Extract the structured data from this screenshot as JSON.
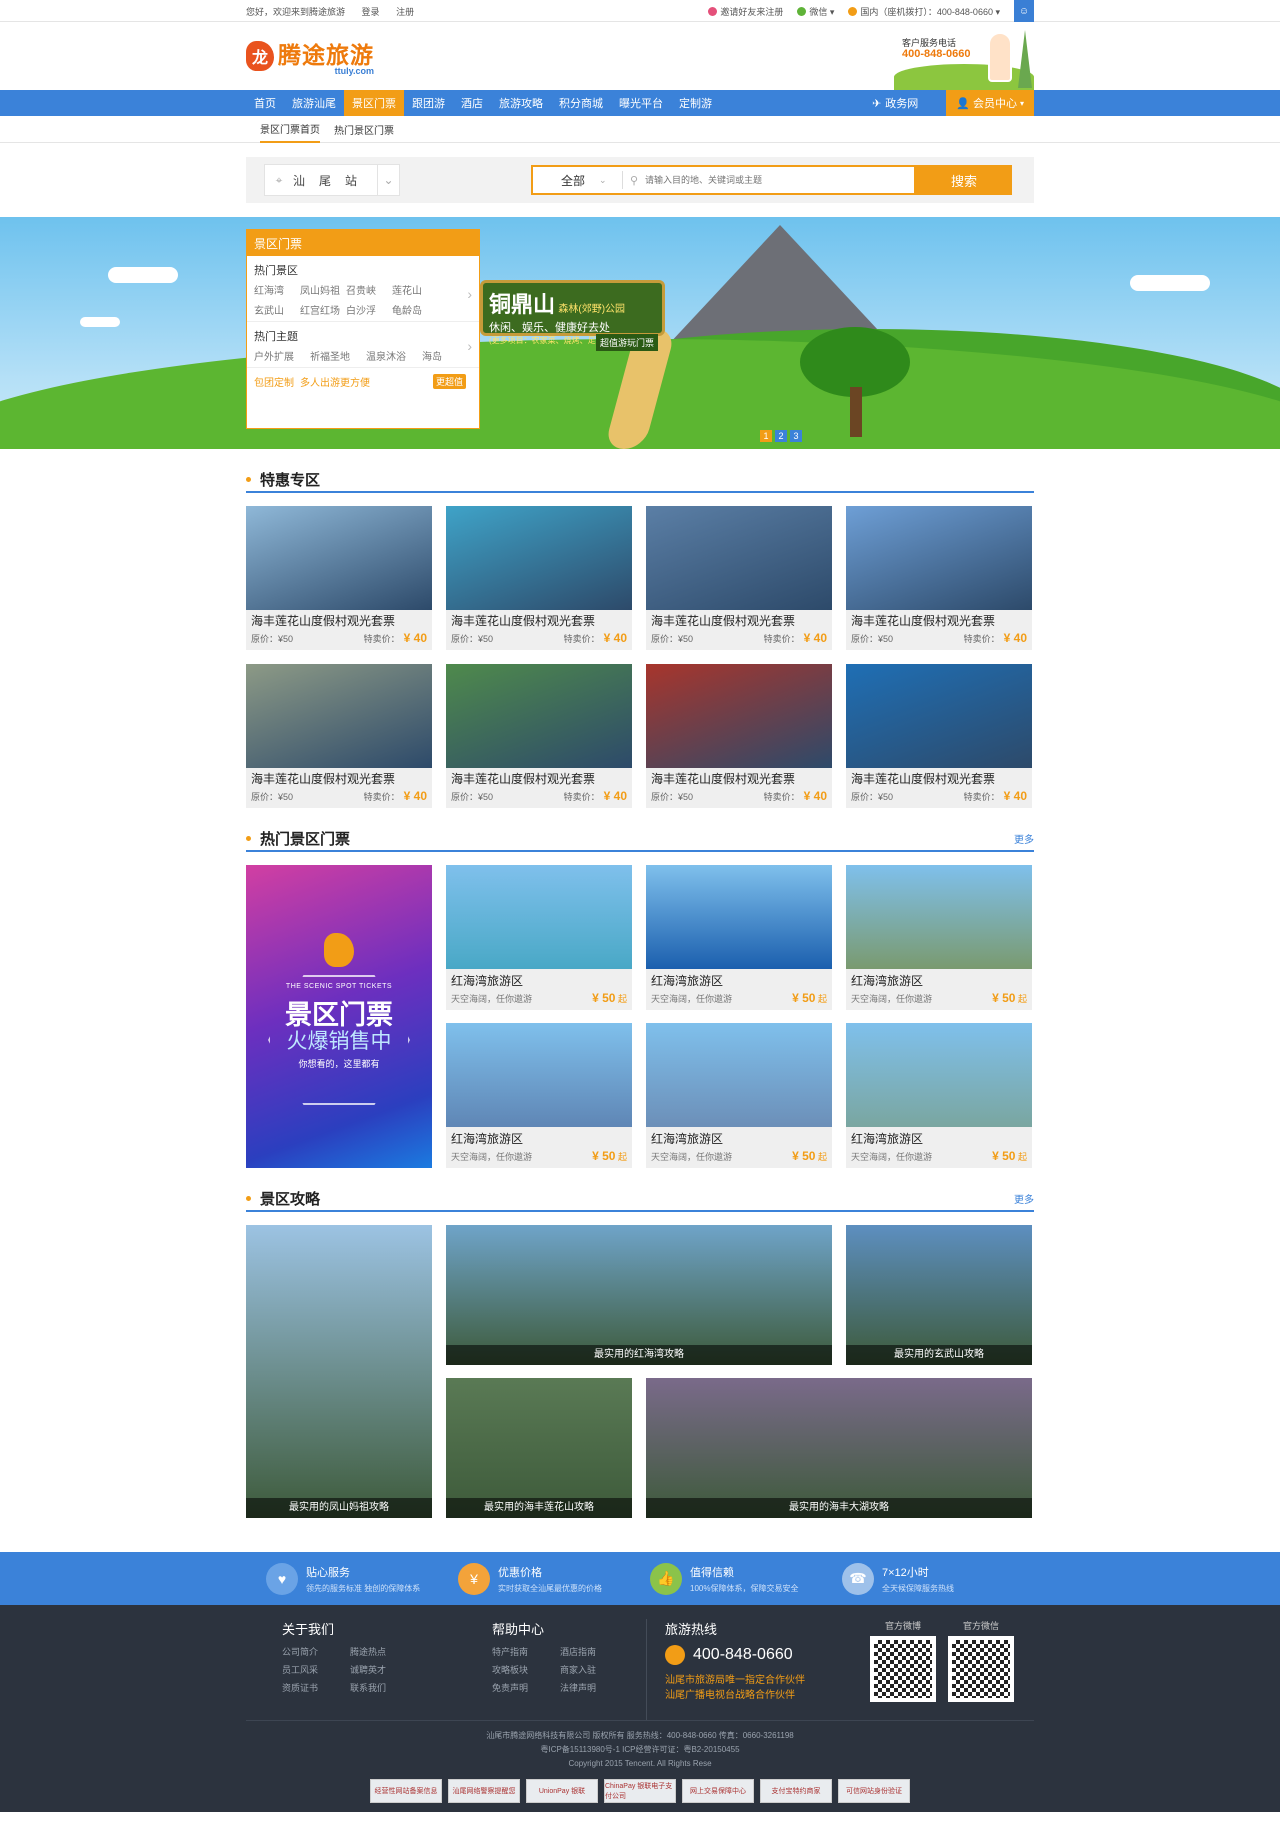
{
  "topbar": {
    "welcome": "您好，欢迎来到腾途旅游",
    "login": "登录",
    "register": "注册",
    "invite": "邀请好友来注册",
    "wechat": "微信",
    "hotline": "国内（座机拨打）：400-848-0660"
  },
  "header": {
    "logo_cn": "腾途旅游",
    "logo_en": "ttuly.com",
    "service_label": "客户服务电话",
    "service_tel": "400-848-0660"
  },
  "nav": {
    "items": [
      "首页",
      "旅游汕尾",
      "景区门票",
      "跟团游",
      "酒店",
      "旅游攻略",
      "积分商城",
      "曝光平台",
      "定制游"
    ],
    "gov": "政务网",
    "member": "会员中心"
  },
  "subnav": {
    "items": [
      "景区门票首页",
      "热门景区门票"
    ]
  },
  "search": {
    "city": "汕尾站",
    "category": "全部",
    "placeholder": "请输入目的地、关键词或主题",
    "button": "搜索"
  },
  "banner": {
    "sign_title": "铜鼎山",
    "sign_sub": "森林(郊野)公园",
    "sign_line": "休闲、娱乐、健康好去处",
    "sign_small": "(更多项目：农家菜、烧烤、足球场、游乐园)",
    "sign_tag": "超值游玩门票",
    "slides": [
      "1",
      "2",
      "3"
    ]
  },
  "panel": {
    "title": "景区门票",
    "hot_spots_title": "热门景区",
    "hot_spots": [
      "红海湾",
      "凤山妈祖",
      "召贵峡",
      "莲花山",
      "玄武山",
      "红宫红场",
      "白沙浮",
      "龟龄岛"
    ],
    "themes_title": "热门主题",
    "themes": [
      "户外扩展",
      "祈福圣地",
      "温泉沐浴",
      "海岛"
    ],
    "custom": "包团定制",
    "custom_sub": "多人出游更方便",
    "value": "更超值"
  },
  "deals": {
    "title": "特惠专区",
    "items": [
      {
        "name": "海丰莲花山度假村观光套票",
        "orig": "原价：¥50",
        "label": "特卖价：",
        "price": "¥ 40",
        "color": "#8fb8d8"
      },
      {
        "name": "海丰莲花山度假村观光套票",
        "orig": "原价：¥50",
        "label": "特卖价：",
        "price": "¥ 40",
        "color": "#3fa3c8"
      },
      {
        "name": "海丰莲花山度假村观光套票",
        "orig": "原价：¥50",
        "label": "特卖价：",
        "price": "¥ 40",
        "color": "#5b7fa6"
      },
      {
        "name": "海丰莲花山度假村观光套票",
        "orig": "原价：¥50",
        "label": "特卖价：",
        "price": "¥ 40",
        "color": "#6e9fd6"
      },
      {
        "name": "海丰莲花山度假村观光套票",
        "orig": "原价：¥50",
        "label": "特卖价：",
        "price": "¥ 40",
        "color": "#8d9a86"
      },
      {
        "name": "海丰莲花山度假村观光套票",
        "orig": "原价：¥50",
        "label": "特卖价：",
        "price": "¥ 40",
        "color": "#4f8a4c"
      },
      {
        "name": "海丰莲花山度假村观光套票",
        "orig": "原价：¥50",
        "label": "特卖价：",
        "price": "¥ 40",
        "color": "#a8352c"
      },
      {
        "name": "海丰莲花山度假村观光套票",
        "orig": "原价：¥50",
        "label": "特卖价：",
        "price": "¥ 40",
        "color": "#1f6fb5"
      }
    ]
  },
  "tickets": {
    "title": "热门景区门票",
    "more": "更多",
    "promo": {
      "en": "THE SCENIC SPOT TICKETS",
      "t1": "景区门票",
      "t2": "火爆销售中",
      "t3": "你想看的，这里都有"
    },
    "items": [
      {
        "name": "红海湾旅游区",
        "desc": "天空海阔，任你遨游",
        "price": "¥ 50",
        "unit": "起",
        "color": "#49a8c6"
      },
      {
        "name": "红海湾旅游区",
        "desc": "天空海阔，任你遨游",
        "price": "¥ 50",
        "unit": "起",
        "color": "#1b5fae"
      },
      {
        "name": "红海湾旅游区",
        "desc": "天空海阔，任你遨游",
        "price": "¥ 50",
        "unit": "起",
        "color": "#7a9a6f"
      },
      {
        "name": "红海湾旅游区",
        "desc": "天空海阔，任你遨游",
        "price": "¥ 50",
        "unit": "起",
        "color": "#5f86b5"
      },
      {
        "name": "红海湾旅游区",
        "desc": "天空海阔，任你遨游",
        "price": "¥ 50",
        "unit": "起",
        "color": "#6c8fb8"
      },
      {
        "name": "红海湾旅游区",
        "desc": "天空海阔，任你遨游",
        "price": "¥ 50",
        "unit": "起",
        "color": "#7aa6a0"
      }
    ]
  },
  "guides": {
    "title": "景区攻略",
    "more": "更多",
    "items": [
      {
        "cap": "最实用的凤山妈祖攻略",
        "color": "#9cc3e3"
      },
      {
        "cap": "最实用的红海湾攻略",
        "color": "#6fa4c9"
      },
      {
        "cap": "最实用的玄武山攻略",
        "color": "#5d8fc0"
      },
      {
        "cap": "最实用的海丰莲花山攻略",
        "color": "#5a7a55"
      },
      {
        "cap": "最实用的海丰大湖攻略",
        "color": "#7a6a8a"
      }
    ]
  },
  "features": [
    {
      "title": "贴心服务",
      "desc": "领先的服务标准 独创的保障体系",
      "color": "#6aa3e6",
      "icon": "♥"
    },
    {
      "title": "优惠价格",
      "desc": "实时获取全汕尾最优惠的价格",
      "color": "#f3a33a",
      "icon": "¥"
    },
    {
      "title": "值得信赖",
      "desc": "100%保障体系，保障交易安全",
      "color": "#8bc34a",
      "icon": "👍"
    },
    {
      "title": "7×12小时",
      "desc": "全天候保障服务热线",
      "color": "#9ec1ea",
      "icon": "☎"
    }
  ],
  "footer": {
    "about": {
      "title": "关于我们",
      "links": [
        "公司简介",
        "腾途热点",
        "员工风采",
        "诚聘英才",
        "资质证书",
        "联系我们"
      ]
    },
    "help": {
      "title": "帮助中心",
      "links": [
        "特产指南",
        "酒店指南",
        "攻略板块",
        "商家入驻",
        "免责声明",
        "法律声明"
      ]
    },
    "hotline": {
      "title": "旅游热线",
      "tel": "400-848-0660",
      "p1": "汕尾市旅游局唯一指定合作伙伴",
      "p2": "汕尾广播电视台战略合作伙伴"
    },
    "weibo": "官方微博",
    "weixin": "官方微信",
    "copy1": "汕尾市腾途网络科技有限公司 版权所有 服务热线：400-848-0660 传真：0660-3261198",
    "copy2": "粤ICP备15113980号-1 ICP经营许可证：粤B2-20150455",
    "copy3": "Copyright 2015 Tencent. All Rights Rese",
    "badges": [
      "经营性网站备案信息",
      "汕尾网络警察提醒您",
      "UnionPay 银联",
      "ChinaPay 银联电子支付公司",
      "网上交易保障中心",
      "支付宝特约商家",
      "可信网站身份验证"
    ]
  }
}
